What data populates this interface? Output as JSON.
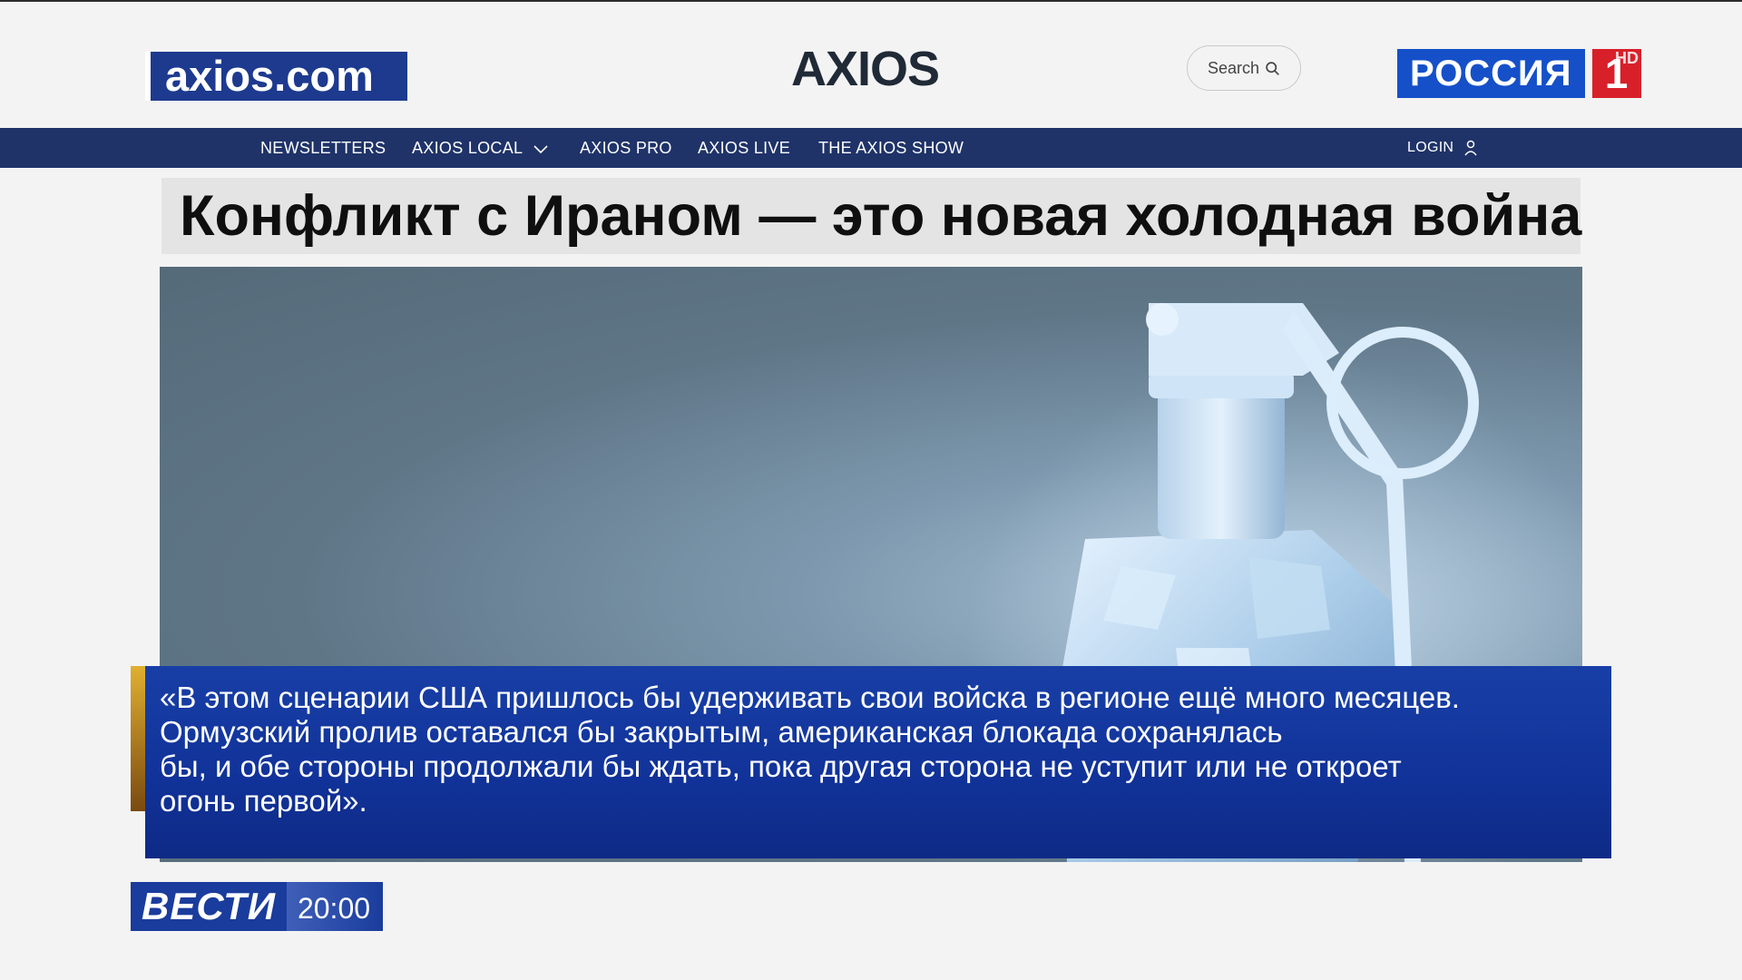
{
  "source_badge": "axios.com",
  "site_logo": "AXIOS",
  "search": {
    "label": "Search",
    "icon": "search-icon"
  },
  "channel": {
    "name": "РОССИЯ",
    "number": "1",
    "hd": "HD"
  },
  "nav": {
    "items": [
      "NEWSLETTERS",
      "AXIOS LOCAL",
      "AXIOS PRO",
      "AXIOS LIVE",
      "THE AXIOS SHOW"
    ],
    "login": "LOGIN"
  },
  "headline": "Конфликт с Ираном — это новая холодная война",
  "quote": {
    "lines": [
      "«В этом сценарии США пришлось бы удерживать свои войска в регионе ещё много месяцев.",
      "Ормузский пролив оставался бы закрытым, американская блокада сохранялась",
      "бы, и обе стороны продолжали бы ждать, пока другая сторона не уступит или не откроет",
      "огонь первой»."
    ]
  },
  "program": {
    "name": "ВЕСТИ",
    "time": "20:00"
  },
  "colors": {
    "nav_bg": "#1f3369",
    "badge_bg": "#1d3a8f",
    "quote_bg": "#13379c",
    "russia_blue": "#1550c9",
    "russia_red": "#d8202a",
    "axios_accent": "#1a5dd6"
  }
}
